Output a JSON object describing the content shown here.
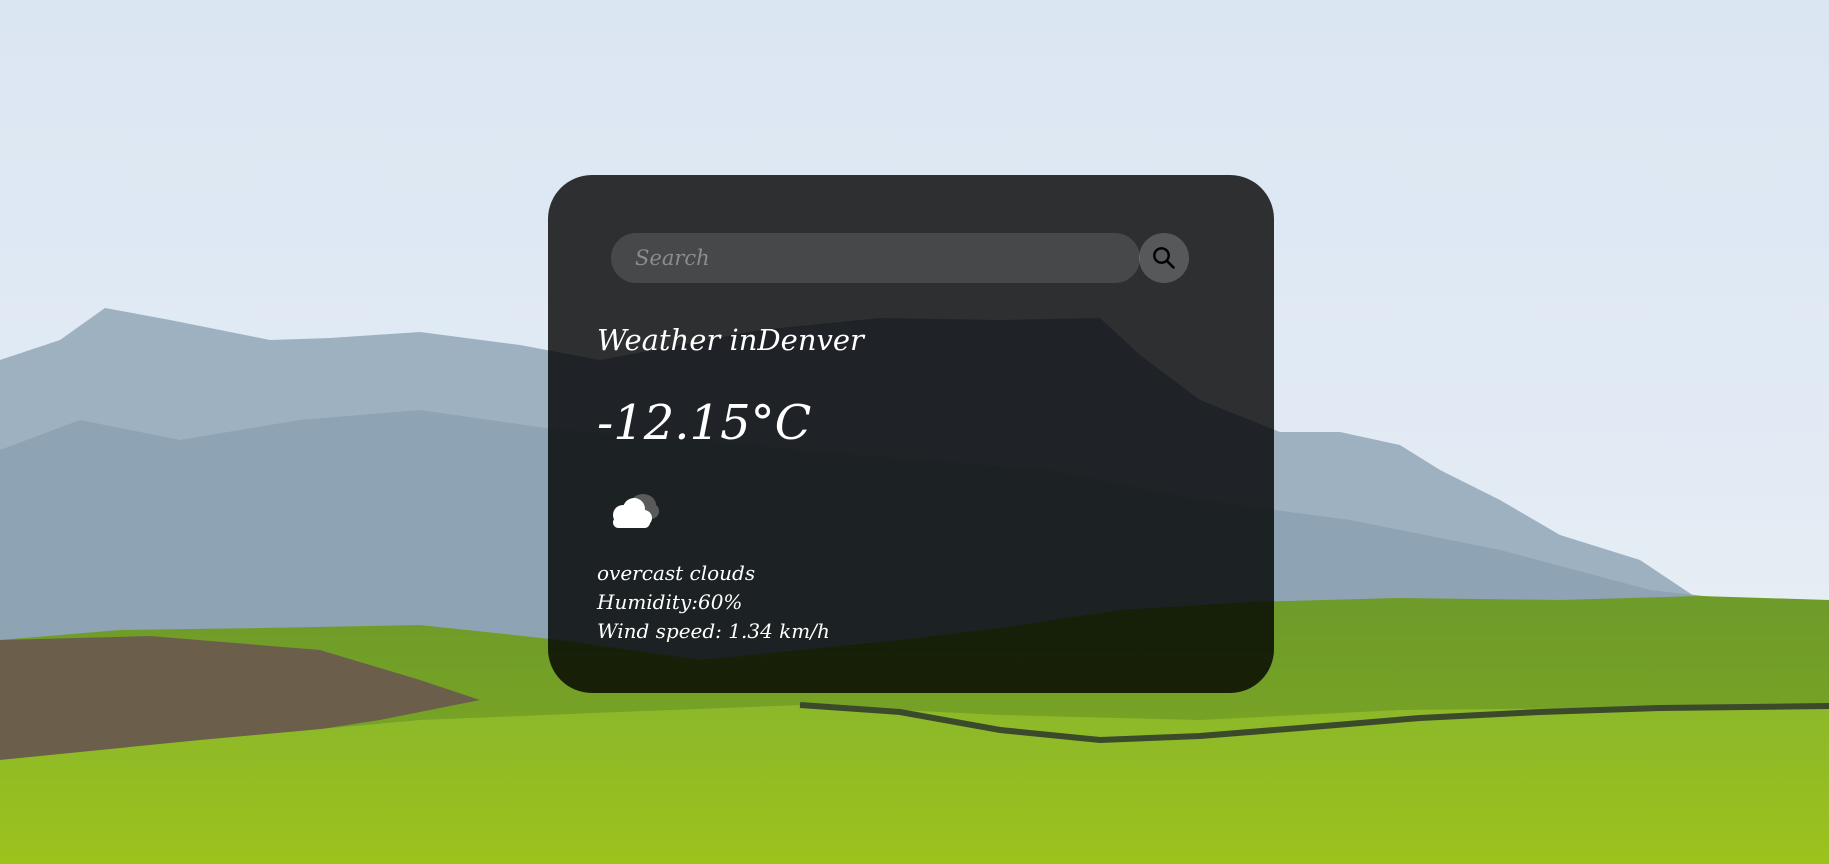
{
  "search": {
    "placeholder": "Search",
    "button_icon": "search-icon"
  },
  "weather": {
    "title_prefix": "Weather in",
    "city": "Denver",
    "temperature": "-12.15°C",
    "icon": "overcast-clouds-icon",
    "description": "overcast clouds",
    "humidity_label": "Humidity:",
    "humidity_value": "60%",
    "wind_label": "Wind speed: ",
    "wind_value": "1.34 km/h"
  },
  "colors": {
    "card_background": "rgba(0,0,0,0.80)",
    "text": "#ffffff",
    "search_field": "#3a3a3a",
    "search_button": "#4a4a4a"
  }
}
